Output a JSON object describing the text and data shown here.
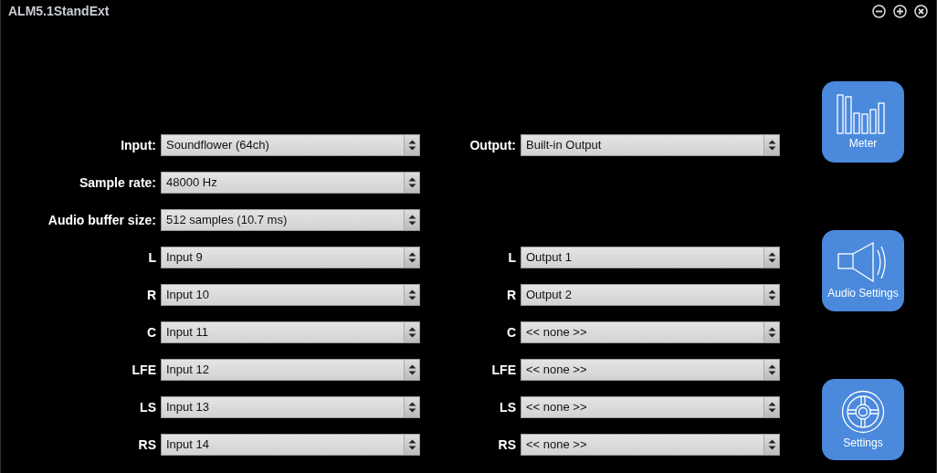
{
  "window": {
    "title": "ALM5.1StandExt",
    "controls": [
      {
        "kind": "minimize"
      },
      {
        "kind": "zoom"
      },
      {
        "kind": "close"
      }
    ]
  },
  "settings": {
    "input": {
      "label": "Input:",
      "value": "Soundflower (64ch)"
    },
    "output": {
      "label": "Output:",
      "value": "Built-in Output"
    },
    "sample_rate": {
      "label": "Sample rate:",
      "value": "48000 Hz"
    },
    "buffer_size": {
      "label": "Audio buffer size:",
      "value": "512 samples (10.7 ms)"
    }
  },
  "channels": [
    {
      "label_in": "L",
      "input": "Input 9",
      "label_out": "L",
      "output": "Output 1"
    },
    {
      "label_in": "R",
      "input": "Input 10",
      "label_out": "R",
      "output": "Output 2"
    },
    {
      "label_in": "C",
      "input": "Input 11",
      "label_out": "C",
      "output": "<< none >>"
    },
    {
      "label_in": "LFE",
      "input": "Input 12",
      "label_out": "LFE",
      "output": "<< none >>"
    },
    {
      "label_in": "LS",
      "input": "Input 13",
      "label_out": "LS",
      "output": "<< none >>"
    },
    {
      "label_in": "RS",
      "input": "Input 14",
      "label_out": "RS",
      "output": "<< none >>"
    }
  ],
  "side_buttons": [
    {
      "kind": "meter",
      "label": "Meter"
    },
    {
      "kind": "speaker",
      "label": "Audio Settings"
    },
    {
      "kind": "wheel",
      "label": "Settings"
    }
  ]
}
